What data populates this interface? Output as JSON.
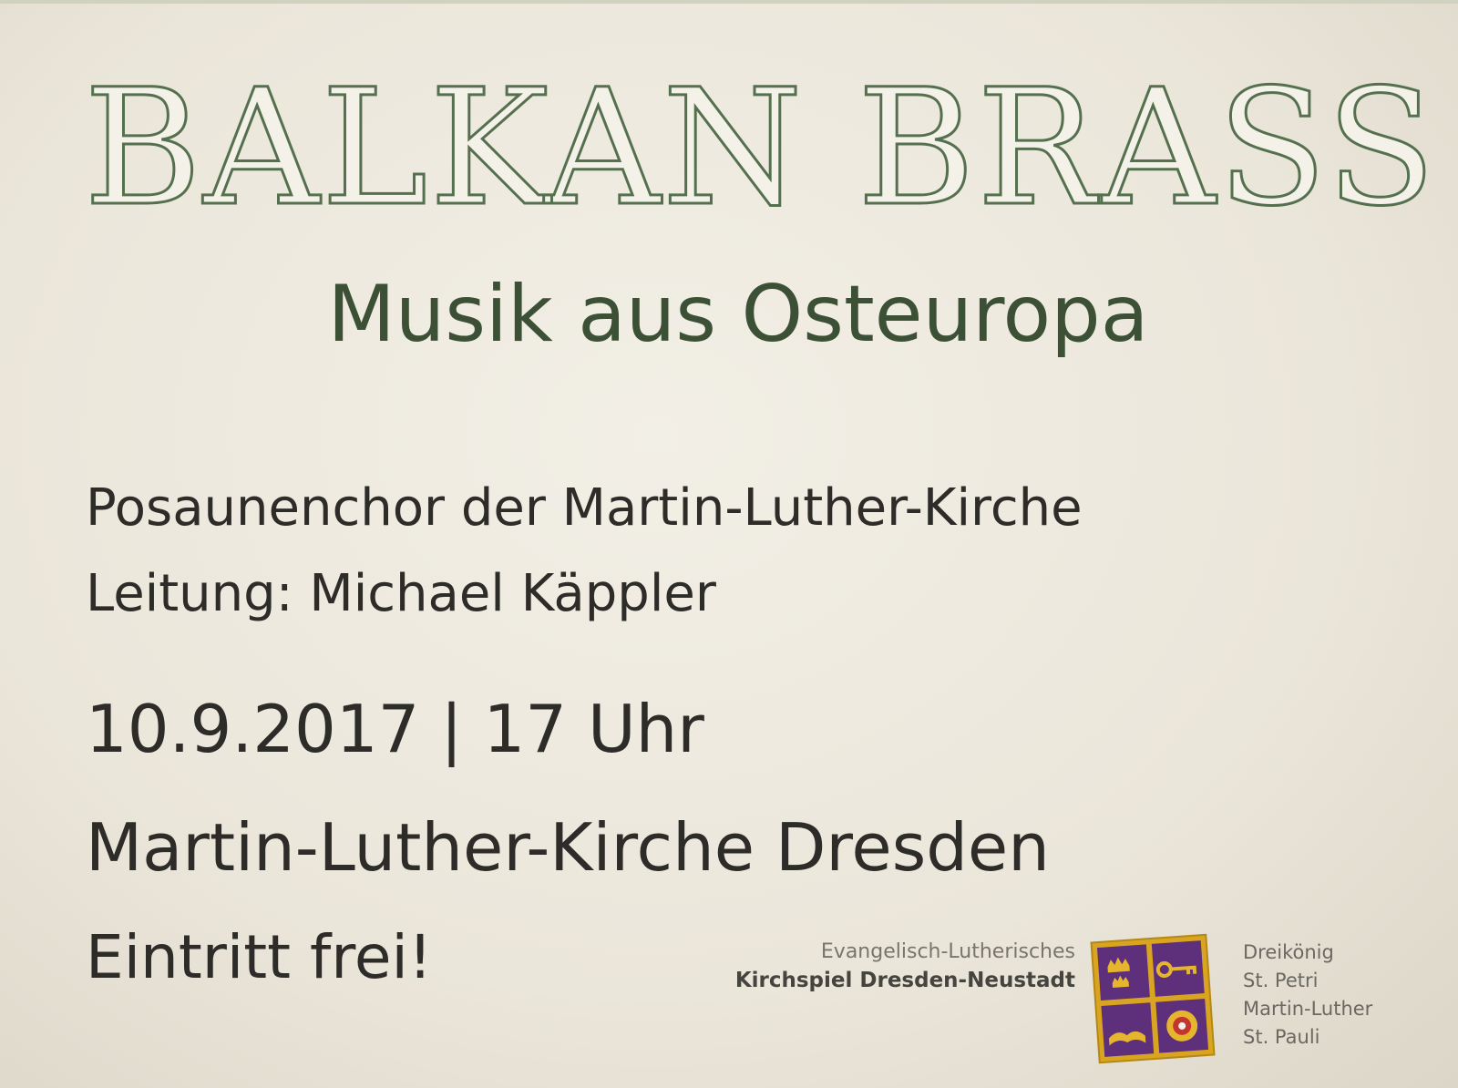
{
  "poster": {
    "title": "BALKAN BRASS!",
    "subtitle": "Musik aus Osteuropa",
    "choir": "Posaunenchor der Martin-Luther-Kirche",
    "conductor": "Leitung: Michael Käppler",
    "datetime": "10.9.2017 | 17 Uhr",
    "venue": "Martin-Luther-Kirche Dresden",
    "admission": "Eintritt frei!"
  },
  "footer": {
    "org_line1": "Evangelisch-Lutherisches",
    "org_line2": "Kirchspiel Dresden-Neustadt",
    "emblem_icons": [
      "crowns-icon",
      "key-icon",
      "book-icon",
      "rose-icon"
    ],
    "parishes": [
      "Dreikönig",
      "St. Petri",
      "Martin-Luther",
      "St. Pauli"
    ]
  },
  "colors": {
    "background": "#ebe6da",
    "title_outline": "#55704f",
    "subtitle": "#3c5036",
    "body_text": "#2d2c28",
    "emblem_purple": "#5e2f7a",
    "emblem_gold": "#d9a521"
  }
}
